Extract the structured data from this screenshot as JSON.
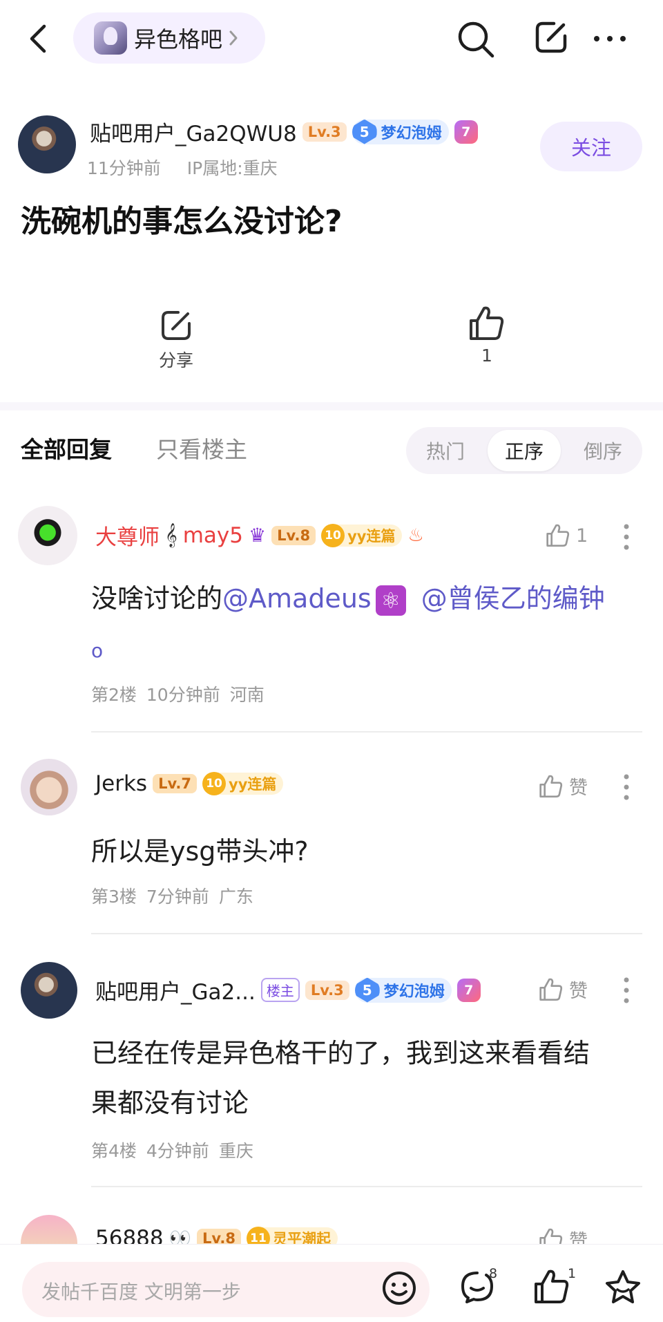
{
  "header": {
    "forum_name": "异色格吧"
  },
  "post": {
    "author": {
      "name": "贴吧用户_Ga2QWU8",
      "level": "Lv.3",
      "badge_num": "5",
      "badge_name": "梦幻泡姆",
      "rank": "7"
    },
    "time": "11分钟前",
    "ip": "IP属地:重庆",
    "follow_label": "关注",
    "title": "洗碗机的事怎么没讨论?",
    "share_label": "分享",
    "like_count": "1"
  },
  "tabs": {
    "all": "全部回复",
    "owner_only": "只看楼主",
    "sort": [
      "热门",
      "正序",
      "倒序"
    ],
    "sort_active": "正序"
  },
  "replies": [
    {
      "name_prefix": "大尊师",
      "name_suffix": "may5",
      "level": "Lv.8",
      "badge_num": "10",
      "badge_name": "yy连篇",
      "like_label": "1",
      "text_lead": "没啥讨论的",
      "mention1": "@Amadeus",
      "mention2": "@曾侯乙的编钟",
      "mention2_cont": "o",
      "floor": "第2楼",
      "time": "10分钟前",
      "location": "河南"
    },
    {
      "name": "Jerks",
      "level": "Lv.7",
      "badge_num": "10",
      "badge_name": "yy连篇",
      "like_label": "赞",
      "text": "所以是ysg带头冲?",
      "floor": "第3楼",
      "time": "7分钟前",
      "location": "广东"
    },
    {
      "name": "贴吧用户_Ga2...",
      "owner_tag": "楼主",
      "level": "Lv.3",
      "badge_num": "5",
      "badge_name": "梦幻泡姆",
      "rank": "7",
      "like_label": "赞",
      "text_line1": "已经在传是异色格干的了，我到这来看看结",
      "text_line2": "果都没有讨论",
      "floor": "第4楼",
      "time": "4分钟前",
      "location": "重庆"
    },
    {
      "name": "56888",
      "level": "Lv.8",
      "badge_num": "11",
      "badge_name": "灵平潮起",
      "like_label": "赞"
    }
  ],
  "bottom": {
    "placeholder": "发帖千百度 文明第一步",
    "comment_count": "8",
    "like_count": "1"
  }
}
